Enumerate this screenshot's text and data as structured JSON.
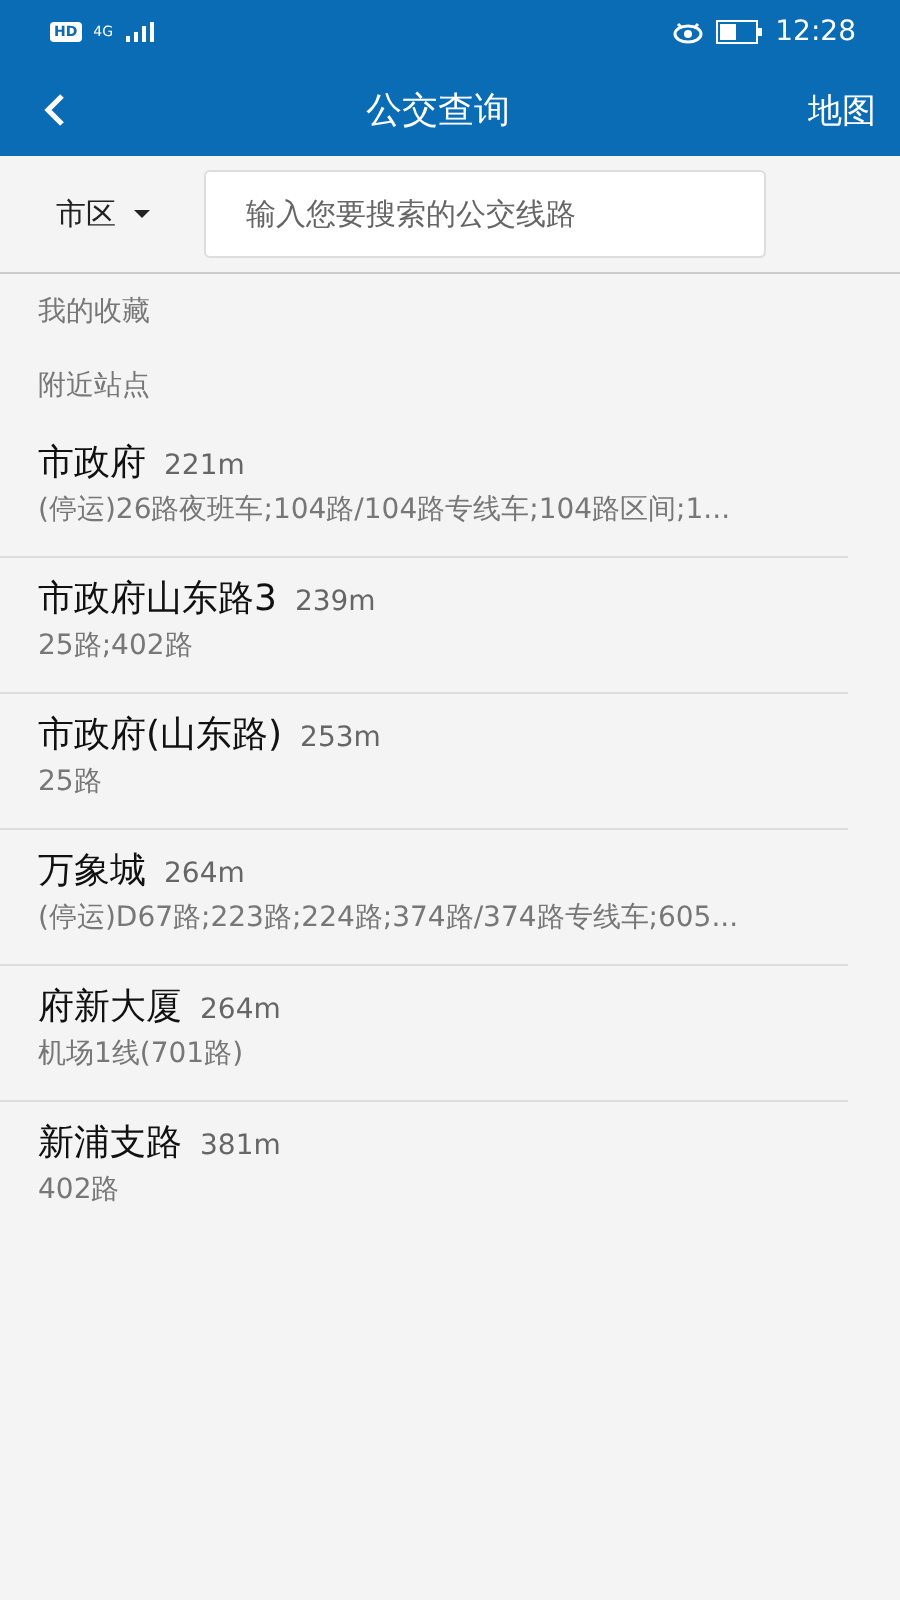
{
  "status_bar": {
    "hd": "HD",
    "network": "4G",
    "time": "12:28"
  },
  "header": {
    "title": "公交查询",
    "action": "地图"
  },
  "search": {
    "region": "市区",
    "placeholder": "输入您要搜索的公交线路"
  },
  "sections": [
    {
      "title": "我的收藏"
    },
    {
      "title": "附近站点"
    }
  ],
  "stops": [
    {
      "name": "市政府",
      "distance": "221m",
      "lines": "(停运)26路夜班车;104路/104路专线车;104路区间;1..."
    },
    {
      "name": "市政府山东路3",
      "distance": "239m",
      "lines": "25路;402路"
    },
    {
      "name": "市政府(山东路)",
      "distance": "253m",
      "lines": "25路"
    },
    {
      "name": "万象城",
      "distance": "264m",
      "lines": "(停运)D67路;223路;224路;374路/374路专线车;605..."
    },
    {
      "name": "府新大厦",
      "distance": "264m",
      "lines": "机场1线(701路)"
    },
    {
      "name": "新浦支路",
      "distance": "381m",
      "lines": "402路"
    }
  ]
}
